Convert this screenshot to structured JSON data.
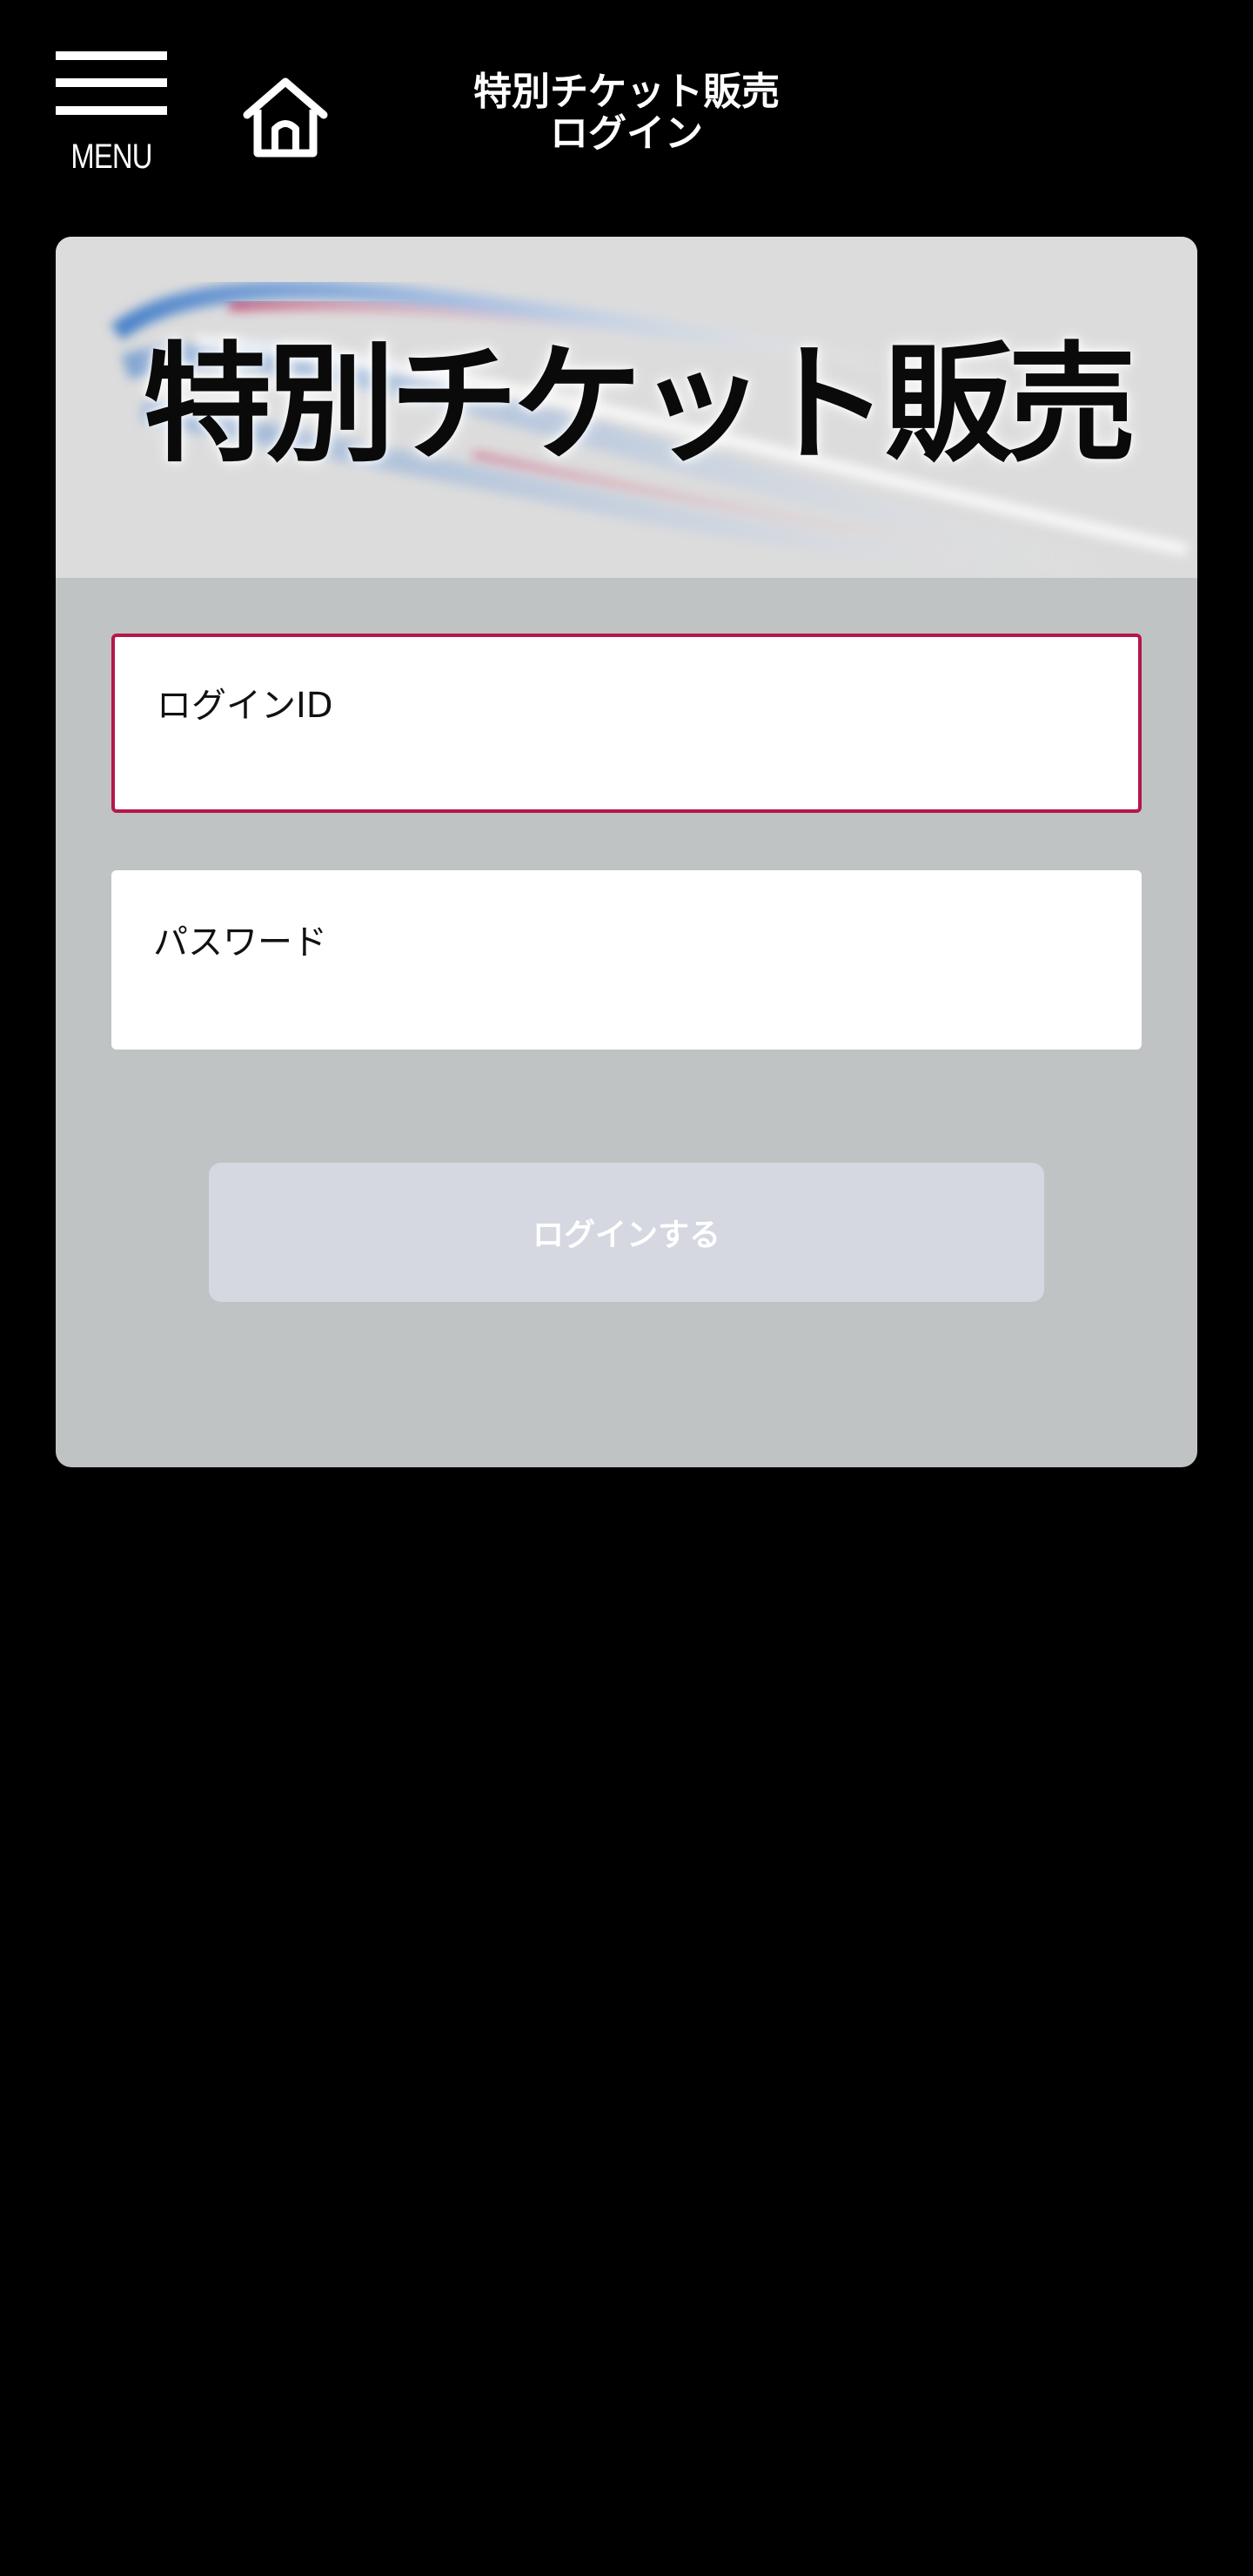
{
  "header": {
    "menu_label": "MENU",
    "title_line1": "特別チケット販売",
    "title_line2": "ログイン"
  },
  "banner": {
    "title": "特別チケット販売"
  },
  "form": {
    "login_id_placeholder": "ログインID",
    "password_placeholder": "パスワード",
    "submit_label": "ログインする"
  },
  "colors": {
    "background": "#000000",
    "card": "#c0c3c4",
    "banner": "#dcdcdc",
    "focus_border": "#b5174b",
    "button_disabled": "#d5d8e0"
  },
  "icons": {
    "menu": "hamburger-icon",
    "home": "home-icon"
  }
}
